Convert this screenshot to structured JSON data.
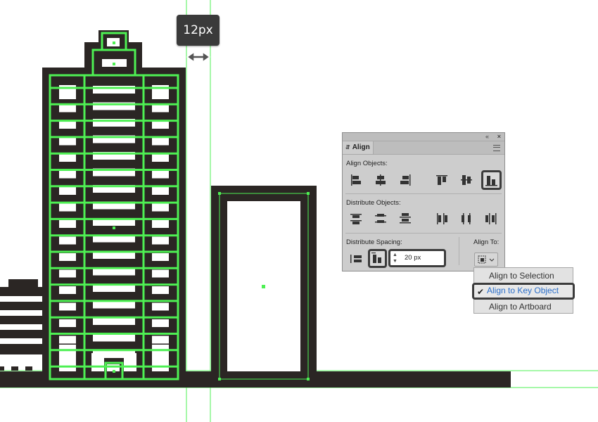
{
  "tooltip": {
    "text": "12px"
  },
  "panel": {
    "title": "Align",
    "align_objects_label": "Align Objects:",
    "distribute_objects_label": "Distribute Objects:",
    "distribute_spacing_label": "Distribute Spacing:",
    "align_to_label": "Align To:",
    "spacing_value": "20 px",
    "top_collapse_icon": "«",
    "top_close_icon": "×"
  },
  "dropdown": {
    "items": [
      "Align to Selection",
      "Align to Key Object",
      "Align to Artboard"
    ],
    "selected": "Align to Key Object",
    "check_glyph": "✔"
  },
  "colors": {
    "building": "#2b2624",
    "selection": "#4ef053",
    "guide": "#4ef053",
    "panel_bg": "#cdcdcd",
    "accent_text": "#2a6ec9"
  }
}
